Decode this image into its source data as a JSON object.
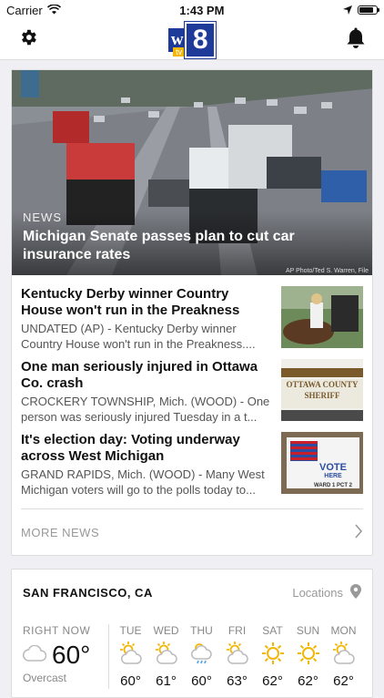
{
  "status": {
    "carrier": "Carrier",
    "time": "1:43 PM",
    "battery_level": 0.85
  },
  "nav": {
    "logo_text": "wood",
    "logo_number": "8",
    "logo_sub": "tv"
  },
  "hero": {
    "category": "NEWS",
    "headline": "Michigan Senate passes plan to cut car insurance rates",
    "credit": "AP Photo/Ted S. Warren, File"
  },
  "stories": [
    {
      "title": "Kentucky Derby winner Country House won't run in the Preakness",
      "summary": "UNDATED (AP) - Kentucky Derby winner Country House won't run in the Preakness...."
    },
    {
      "title": "One man seriously injured in Ottawa Co. crash",
      "summary": "CROCKERY TOWNSHIP, Mich. (WOOD) - One person was seriously injured Tuesday in a t..."
    },
    {
      "title": "It's election day: Voting underway across West Michigan",
      "summary": "GRAND RAPIDS, Mich. (WOOD) - Many West Michigan voters will go to the polls today to..."
    }
  ],
  "thumb_text": {
    "sheriff": "OTTAWA COUNTY SHERIFF",
    "vote": "VOTE",
    "vote_here": "HERE",
    "ward": "WARD 1 PCT 2"
  },
  "more_news": "MORE NEWS",
  "weather": {
    "city": "SAN FRANCISCO, CA",
    "locations_label": "Locations",
    "now_label": "RIGHT NOW",
    "now_temp": "60°",
    "now_condition": "Overcast",
    "days": [
      {
        "name": "TUE",
        "icon": "partly-sunny-icon",
        "temp": "60°"
      },
      {
        "name": "WED",
        "icon": "partly-sunny-icon",
        "temp": "61°"
      },
      {
        "name": "THU",
        "icon": "rain-icon",
        "temp": "60°"
      },
      {
        "name": "FRI",
        "icon": "partly-sunny-icon",
        "temp": "63°"
      },
      {
        "name": "SAT",
        "icon": "sun-icon",
        "temp": "62°"
      },
      {
        "name": "SUN",
        "icon": "sun-icon",
        "temp": "62°"
      },
      {
        "name": "MON",
        "icon": "partly-sunny-icon",
        "temp": "62°"
      }
    ]
  },
  "colors": {
    "brand": "#1e3b9a",
    "sun": "#f2b705"
  }
}
